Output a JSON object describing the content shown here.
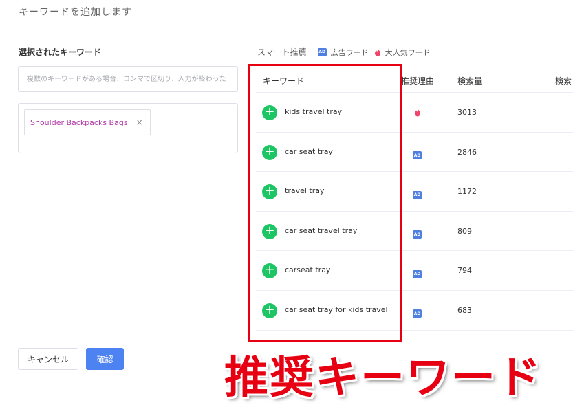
{
  "page_title": "キーワードを追加します",
  "left_panel": {
    "title": "選択されたキーワード",
    "input_placeholder": "複数のキーワードがある場合、コンマで区切り、入力が終わった",
    "selected_tags": [
      {
        "label": "Shoulder Backpacks Bags",
        "close": "×"
      }
    ]
  },
  "smart": {
    "title": "スマート推薦",
    "legend_ad_badge": "AD",
    "legend_ad_label": "広告ワード",
    "legend_hot_label": "大人気ワード"
  },
  "table": {
    "headers": [
      "キーワード",
      "推奨理由",
      "検索量",
      "検索"
    ],
    "rows": [
      {
        "keyword": "kids travel tray",
        "reason": "hot",
        "volume": "3013"
      },
      {
        "keyword": "car seat tray",
        "reason": "ad",
        "volume": "2846"
      },
      {
        "keyword": "travel tray",
        "reason": "ad",
        "volume": "1172"
      },
      {
        "keyword": "car seat travel tray",
        "reason": "ad",
        "volume": "809"
      },
      {
        "keyword": "carseat tray",
        "reason": "ad",
        "volume": "794"
      },
      {
        "keyword": "car seat tray for kids travel",
        "reason": "ad",
        "volume": "683"
      }
    ],
    "add_symbol": "+",
    "ad_badge_text": "AD"
  },
  "buttons": {
    "cancel": "キャンセル",
    "confirm": "確認"
  },
  "overlay_caption": "推奨キーワード",
  "colors": {
    "accent_blue": "#4d82f3",
    "add_green": "#1ec564",
    "highlight_red": "#e60012",
    "tag_purple": "#b23aa8",
    "hot_pink": "#f0466b"
  }
}
